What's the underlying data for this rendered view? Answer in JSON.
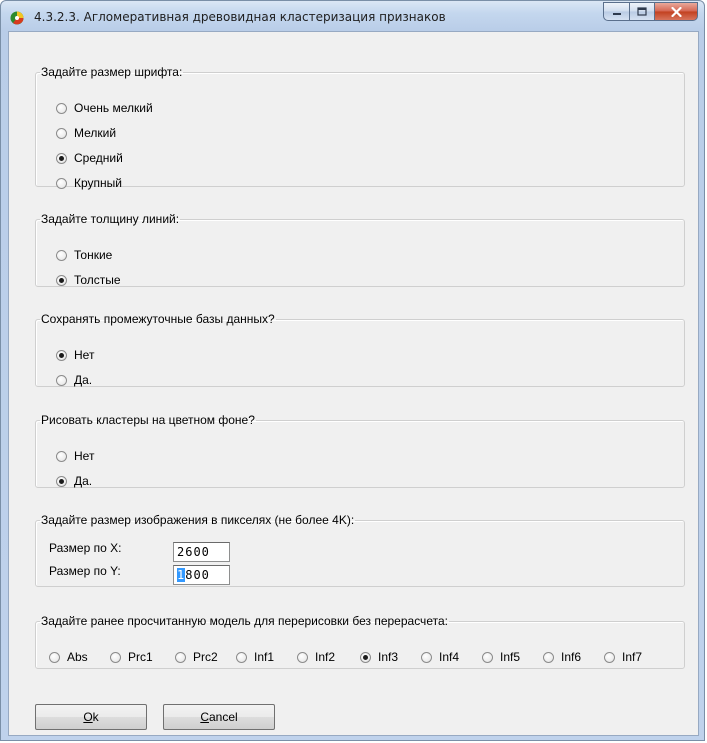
{
  "window": {
    "title": "4.3.2.3. Агломеративная древовидная кластеризация признаков"
  },
  "font_group": {
    "legend": "Задайте размер шрифта:",
    "options": [
      {
        "label": "Очень мелкий",
        "checked": false
      },
      {
        "label": "Мелкий",
        "checked": false
      },
      {
        "label": "Средний",
        "checked": true
      },
      {
        "label": "Крупный",
        "checked": false
      }
    ]
  },
  "line_group": {
    "legend": "Задайте толщину линий:",
    "options": [
      {
        "label": "Тонкие",
        "checked": false
      },
      {
        "label": "Толстые",
        "checked": true
      }
    ]
  },
  "save_group": {
    "legend": "Сохранять промежуточные базы данных?",
    "options": [
      {
        "label": "Нет",
        "checked": true
      },
      {
        "label": "Да.",
        "checked": false
      }
    ]
  },
  "color_group": {
    "legend": "Рисовать кластеры на цветном фоне?",
    "options": [
      {
        "label": "Нет",
        "checked": false
      },
      {
        "label": "Да.",
        "checked": true
      }
    ]
  },
  "size_group": {
    "legend": "Задайте размер изображения в пикселях (не более 4K):",
    "x_label": "Размер по X:",
    "x_value": "2600",
    "y_label": "Размер по Y:",
    "y_value_selected": "1",
    "y_value_rest": "800"
  },
  "model_group": {
    "legend": "Задайте ранее просчитанную модель для перерисовки без перерасчета:",
    "options": [
      {
        "label": "Abs",
        "checked": false
      },
      {
        "label": "Prc1",
        "checked": false
      },
      {
        "label": "Prc2",
        "checked": false
      },
      {
        "label": "Inf1",
        "checked": false
      },
      {
        "label": "Inf2",
        "checked": false
      },
      {
        "label": "Inf3",
        "checked": true
      },
      {
        "label": "Inf4",
        "checked": false
      },
      {
        "label": "Inf5",
        "checked": false
      },
      {
        "label": "Inf6",
        "checked": false
      },
      {
        "label": "Inf7",
        "checked": false
      }
    ]
  },
  "buttons": {
    "ok_mnemonic": "O",
    "ok_rest": "k",
    "cancel_mnemonic": "C",
    "cancel_rest": "ancel"
  },
  "icons": {
    "app": "app-icon",
    "minimize": "minimize-icon",
    "maximize": "maximize-icon",
    "close": "close-icon"
  },
  "colors": {
    "selection": "#3399ff",
    "close_button": "#c2401f",
    "client_background": "#f0f0f0"
  }
}
